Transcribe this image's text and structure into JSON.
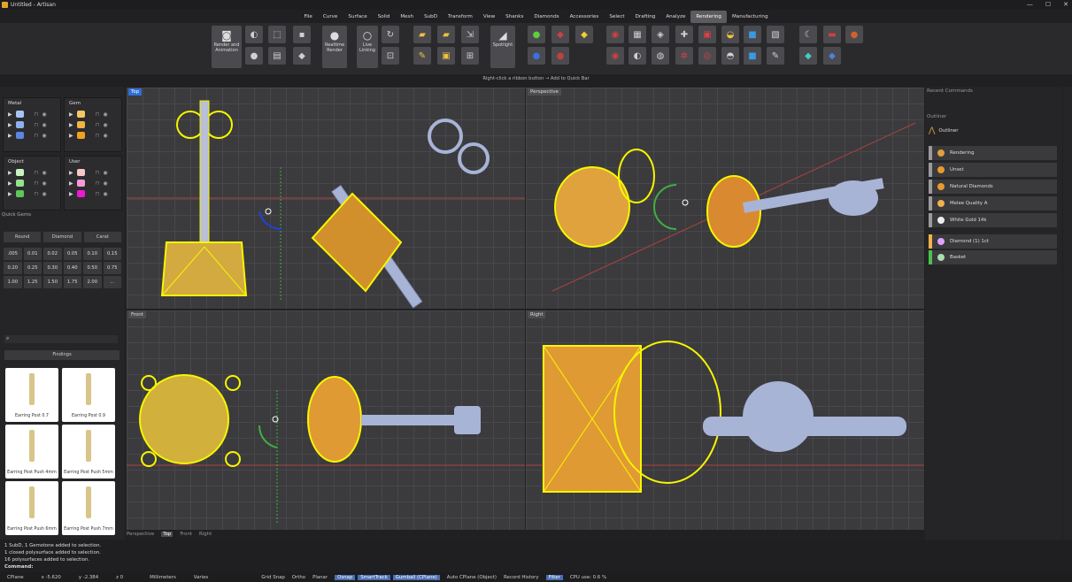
{
  "window": {
    "title": "Untitled - Artisan",
    "min": "—",
    "max": "☐",
    "close": "✕"
  },
  "menu": [
    "File",
    "Curve",
    "Surface",
    "Solid",
    "Mesh",
    "SubD",
    "Transform",
    "View",
    "Shanks",
    "Diamonds",
    "Accessories",
    "Select",
    "Drafting",
    "Analyze",
    "Rendering",
    "Manufacturing"
  ],
  "menu_active": "Rendering",
  "ribbon": {
    "render_animation": "Render and Animation",
    "realtime_render": "Realtime Render",
    "live_linking": "Live Linking",
    "spotlight": "Spotlight"
  },
  "hint": "Right-click a ribbon button → Add to Quick Bar",
  "layers": {
    "metal": "Metal",
    "gem": "Gem",
    "object": "Object",
    "user": "User"
  },
  "layer_colors": {
    "metal": [
      "#a9c4f4",
      "#8eb0ee",
      "#5b85e0"
    ],
    "gem": [
      "#f5c663",
      "#f2b53e",
      "#f0a21c"
    ],
    "object": [
      "#c9f2c1",
      "#94e38b",
      "#5cc75a"
    ],
    "user": [
      "#f7c6c6",
      "#f59ad6",
      "#ee19d2"
    ]
  },
  "quick_gems": {
    "title": "Quick Gems",
    "round": "Round",
    "diamond": "Diamond",
    "carat": "Carat",
    "values": [
      ".005",
      "0.01",
      "0.02",
      "0.05",
      "0.10",
      "0.15",
      "0.20",
      "0.25",
      "0.30",
      "0.40",
      "0.50",
      "0.75",
      "1.00",
      "1.25",
      "1.50",
      "1.75",
      "2.00",
      "..."
    ]
  },
  "findings": {
    "title": "Findings",
    "items": [
      "Earring Post 0.7",
      "Earring Post 0.9",
      "Earring Post Push 4mm",
      "Earring Post Push 5mm",
      "Earring Post Push 6mm",
      "Earring Post Push 7mm"
    ]
  },
  "viewports": {
    "top": "Top",
    "perspective": "Perspective",
    "front": "Front",
    "right": "Right"
  },
  "view_tabs": [
    "Perspective",
    "Top",
    "Front",
    "Right"
  ],
  "view_tab_active": "Top",
  "recent_commands": "Recent Commands",
  "outliner": {
    "title": "Outliner",
    "header": "Outliner",
    "rows": [
      {
        "label": "Rendering",
        "bar": "#9a9a9e",
        "icon": "#e0a040"
      },
      {
        "label": "Unset",
        "bar": "#9a9a9e",
        "icon": "#e89a2c"
      },
      {
        "label": "Natural Diamonds",
        "bar": "#9a9a9e",
        "icon": "#e89a2c"
      },
      {
        "label": "Melee Quality A",
        "bar": "#9a9a9e",
        "icon": "#f0b34b"
      },
      {
        "label": "White Gold 14k",
        "bar": "#9a9a9e",
        "icon": "#eeeeee"
      },
      {
        "label": "Diamond (1) 1ct",
        "bar": "#f0b34b",
        "icon": "#e0a0ff"
      },
      {
        "label": "Basket",
        "bar": "#4bc24b",
        "icon": "#aaddaa"
      }
    ]
  },
  "command_history": [
    "1 SubD, 1 Gemstone added to selection.",
    "1 closed polysurface added to selection.",
    "16 polysurfaces added to selection."
  ],
  "command_prompt": "Command:",
  "status": {
    "cplane": "CPlane",
    "x": "x -5.620",
    "y": "y -2.384",
    "z": "z 0",
    "units": "Millimeters",
    "varies": "Varies",
    "grid_snap": "Grid Snap",
    "ortho": "Ortho",
    "planar": "Planar",
    "osnap": "Osnap",
    "smarttrack": "SmartTrack",
    "gumball": "Gumball (CPlane)",
    "auto_cplane": "Auto CPlane (Object)",
    "record_history": "Record History",
    "filter": "Filter",
    "cpu": "CPU use: 0.6 %"
  }
}
